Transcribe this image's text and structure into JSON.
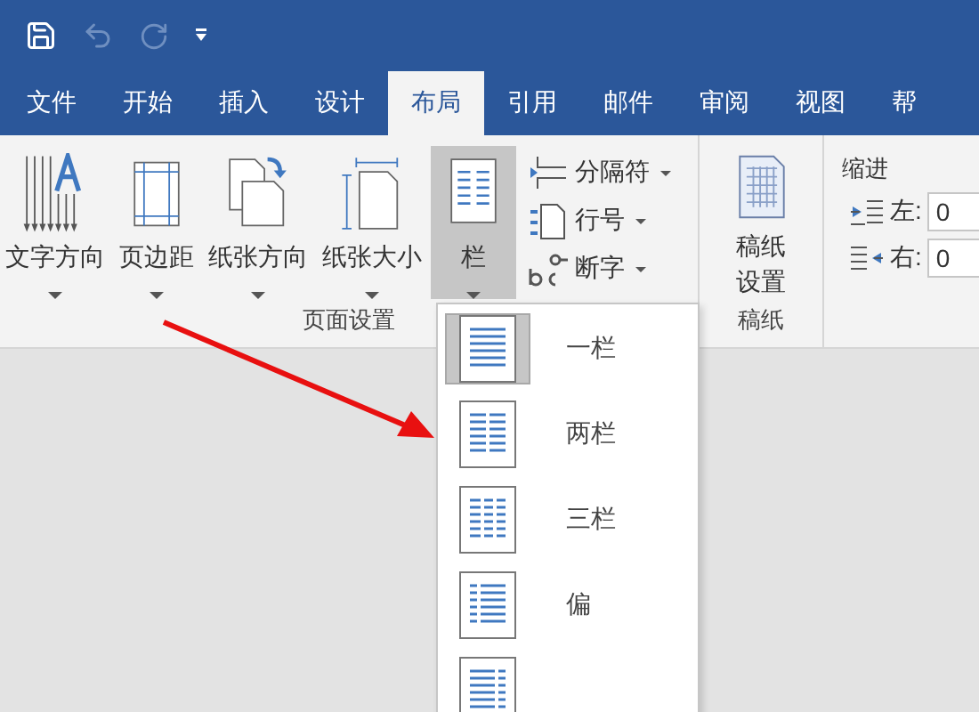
{
  "quick_access": [
    {
      "kind": "save",
      "disabled": false
    },
    {
      "kind": "undo",
      "disabled": true
    },
    {
      "kind": "redo",
      "disabled": true
    },
    {
      "kind": "customize",
      "disabled": false
    }
  ],
  "tabs": [
    {
      "label": "文件",
      "selected": false
    },
    {
      "label": "开始",
      "selected": false
    },
    {
      "label": "插入",
      "selected": false
    },
    {
      "label": "设计",
      "selected": false
    },
    {
      "label": "布局",
      "selected": true
    },
    {
      "label": "引用",
      "selected": false
    },
    {
      "label": "邮件",
      "selected": false
    },
    {
      "label": "审阅",
      "selected": false
    },
    {
      "label": "视图",
      "selected": false
    },
    {
      "label": "帮",
      "selected": false
    }
  ],
  "page_setup": {
    "label": "页面设置",
    "large_buttons": [
      {
        "kind": "text-direction",
        "label": "文字方向",
        "pressed": false
      },
      {
        "kind": "margins",
        "label": "页边距",
        "pressed": false
      },
      {
        "kind": "orientation",
        "label": "纸张方向",
        "pressed": false
      },
      {
        "kind": "size",
        "label": "纸张大小",
        "pressed": false
      },
      {
        "kind": "columns",
        "label": "栏",
        "pressed": true
      }
    ],
    "small_buttons": [
      {
        "kind": "breaks",
        "label": "分隔符"
      },
      {
        "kind": "line-numbers",
        "label": "行号"
      },
      {
        "kind": "hyphenation",
        "label": "断字"
      }
    ]
  },
  "manuscript": {
    "label": "稿纸",
    "button": "稿纸设置"
  },
  "indent": {
    "title": "缩进",
    "fields": [
      {
        "kind": "left",
        "label": "左:",
        "value": "0"
      },
      {
        "kind": "right",
        "label": "右:",
        "value": "0"
      }
    ]
  },
  "columns_menu": [
    {
      "kind": "one",
      "label": "一栏",
      "selected": true
    },
    {
      "kind": "two",
      "label": "两栏",
      "selected": false
    },
    {
      "kind": "three",
      "label": "三栏",
      "selected": false
    },
    {
      "kind": "left",
      "label": "偏",
      "selected": false
    },
    {
      "kind": "right",
      "selected": false
    }
  ]
}
